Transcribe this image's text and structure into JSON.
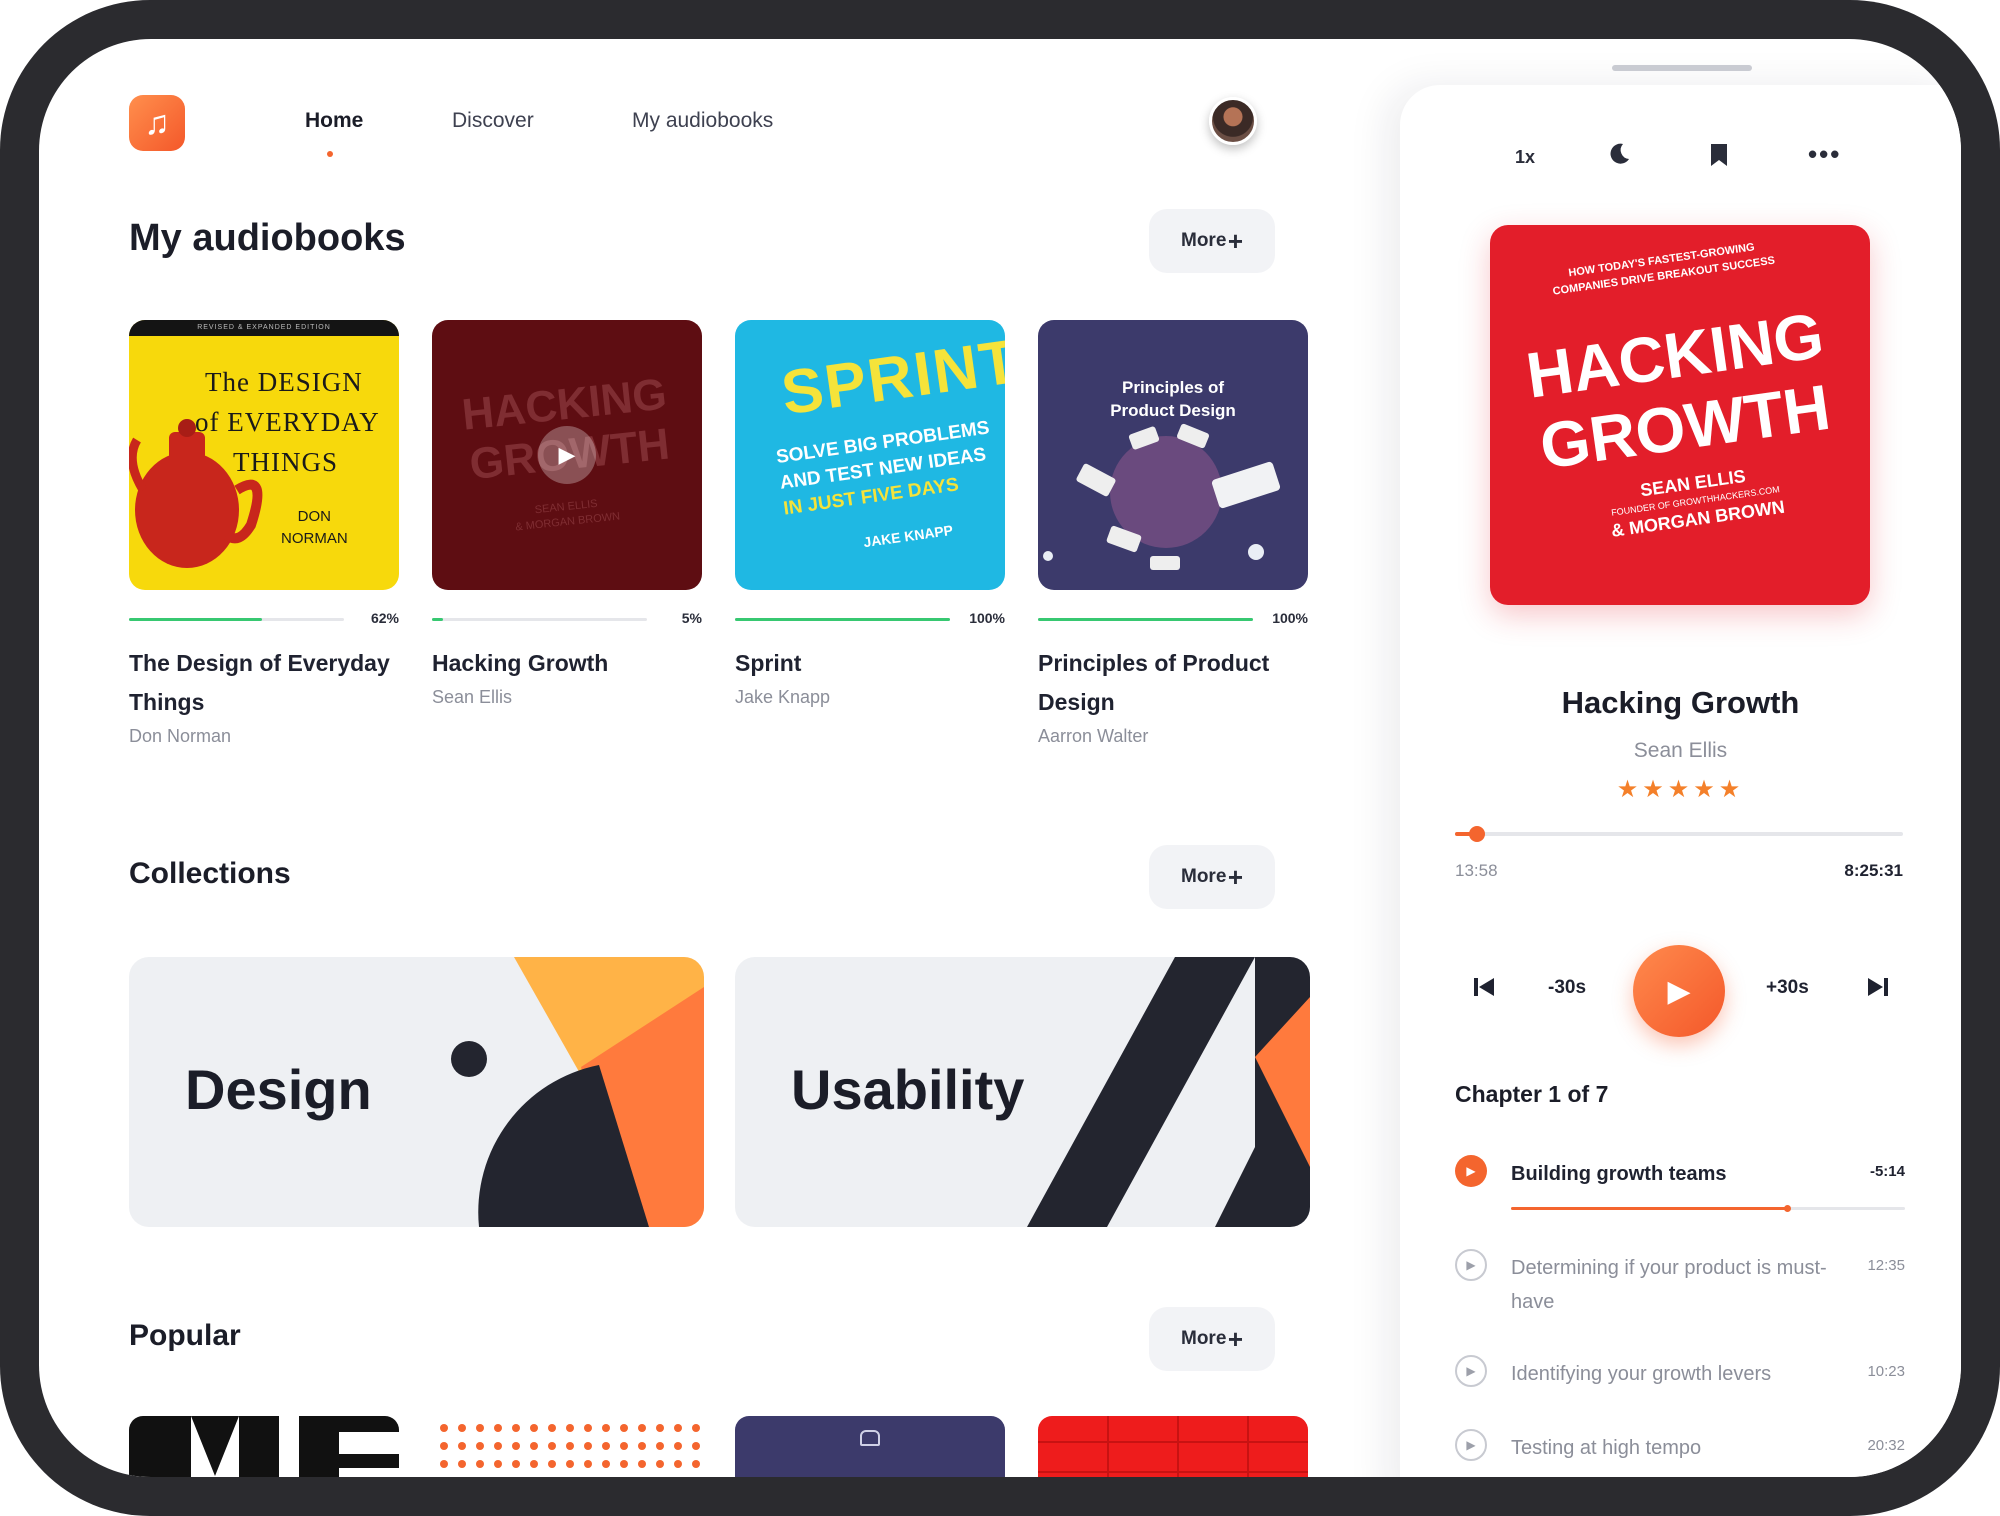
{
  "nav": {
    "logo_icon": "music-note-icon",
    "items": [
      {
        "label": "Home",
        "active": true
      },
      {
        "label": "Discover",
        "active": false
      },
      {
        "label": "My audiobooks",
        "active": false
      }
    ]
  },
  "sections": {
    "audiobooks_title": "My audiobooks",
    "collections_title": "Collections",
    "popular_title": "Popular",
    "more_label": "More"
  },
  "books": [
    {
      "title": "The Design of Everyday Things",
      "author": "Don Norman",
      "progress": 62,
      "progress_label": "62%",
      "cover_text": [
        "REVISED & EXPANDED EDITION",
        "The DESIGN",
        "of EVERYDAY",
        "THINGS",
        "DON",
        "NORMAN"
      ],
      "cover_color": "#f7d90c"
    },
    {
      "title": "Hacking Growth",
      "author": "Sean Ellis",
      "progress": 5,
      "progress_label": "5%",
      "cover_text": [
        "HACKING",
        "GROWTH",
        "SEAN ELLIS",
        "& MORGAN BROWN"
      ],
      "cover_color": "#5e0d12"
    },
    {
      "title": "Sprint",
      "author": "Jake Knapp",
      "progress": 100,
      "progress_label": "100%",
      "cover_text": [
        "SPRINT",
        "SOLVE BIG PROBLEMS",
        "AND TEST NEW IDEAS",
        "IN JUST FIVE DAYS",
        "JAKE KNAPP"
      ],
      "cover_color": "#1fb8e3"
    },
    {
      "title": "Principles of Product Design",
      "author": "Aarron Walter",
      "progress": 100,
      "progress_label": "100%",
      "cover_text": [
        "Principles of",
        "Product Design"
      ],
      "cover_color": "#3c3a6b"
    }
  ],
  "collections": [
    {
      "label": "Design"
    },
    {
      "label": "Usability"
    }
  ],
  "player": {
    "speed_label": "1x",
    "tool_icons": [
      "moon-icon",
      "bookmark-icon",
      "more-horizontal-icon"
    ],
    "cover_text": [
      "HOW TODAY'S FASTEST-GROWING",
      "COMPANIES DRIVE BREAKOUT SUCCESS",
      "HACKING",
      "GROWTH",
      "SEAN ELLIS",
      "FOUNDER OF GROWTHHACKERS.COM",
      "& MORGAN BROWN"
    ],
    "title": "Hacking Growth",
    "author": "Sean Ellis",
    "rating": 5,
    "stars": "★★★★★",
    "elapsed": "13:58",
    "total": "8:25:31",
    "position": 0.05,
    "back_label": "-30s",
    "forward_label": "+30s",
    "chapter_label": "Chapter 1 of 7",
    "chapters": [
      {
        "name": "Building growth teams",
        "time": "-5:14",
        "active": true,
        "progress": 0.7
      },
      {
        "name": "Determining if your product is must-have",
        "time": "12:35",
        "active": false
      },
      {
        "name": "Identifying your growth levers",
        "time": "10:23",
        "active": false
      },
      {
        "name": "Testing at high tempo",
        "time": "20:32",
        "active": false
      }
    ],
    "accent": "#f4652e"
  }
}
